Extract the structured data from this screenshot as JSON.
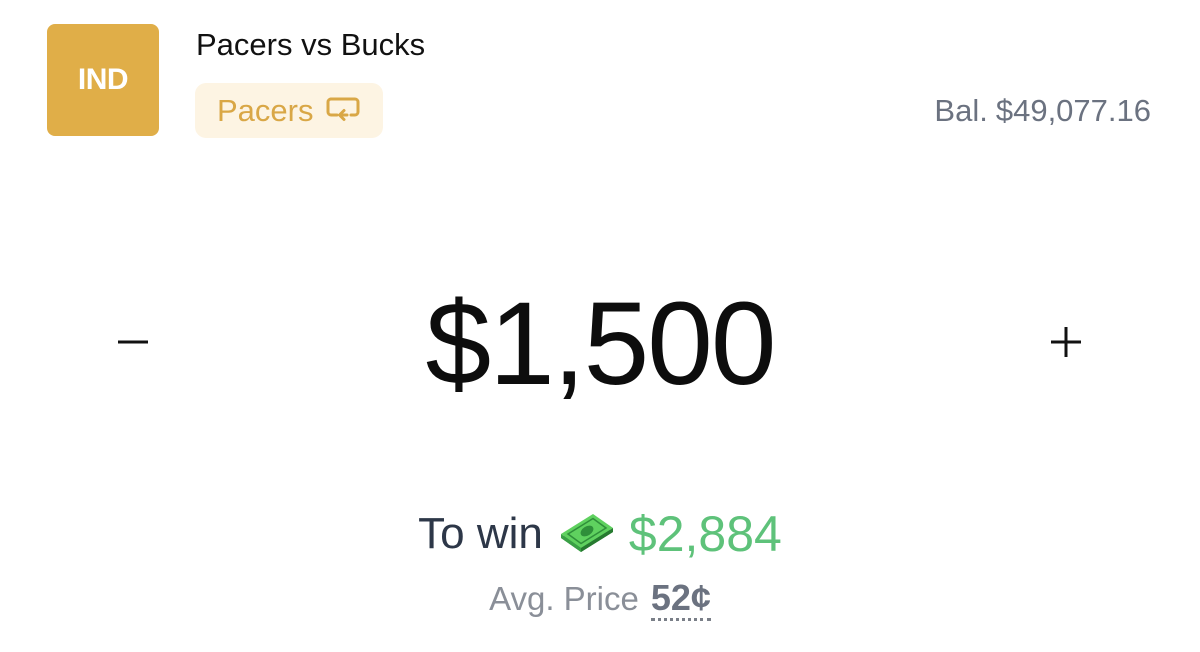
{
  "header": {
    "team_logo_text": "IND",
    "market_title": "Pacers vs Bucks",
    "selected_side": "Pacers",
    "switch_icon": "swap-arrow-icon",
    "balance_prefix": "Bal.",
    "balance_value": "$49,077.16"
  },
  "colors": {
    "team_gold": "#e0ae48",
    "pill_bg": "#fdf4e3",
    "pill_text": "#d9a746",
    "win_green": "#5ec27a"
  },
  "wager": {
    "minus_symbol": "−",
    "plus_symbol": "+",
    "amount": "$1,500"
  },
  "payout": {
    "to_win_label": "To win",
    "money_icon": "money-bill-icon",
    "to_win_value": "$2,884",
    "avg_price_label": "Avg. Price",
    "avg_price_value": "52¢"
  }
}
